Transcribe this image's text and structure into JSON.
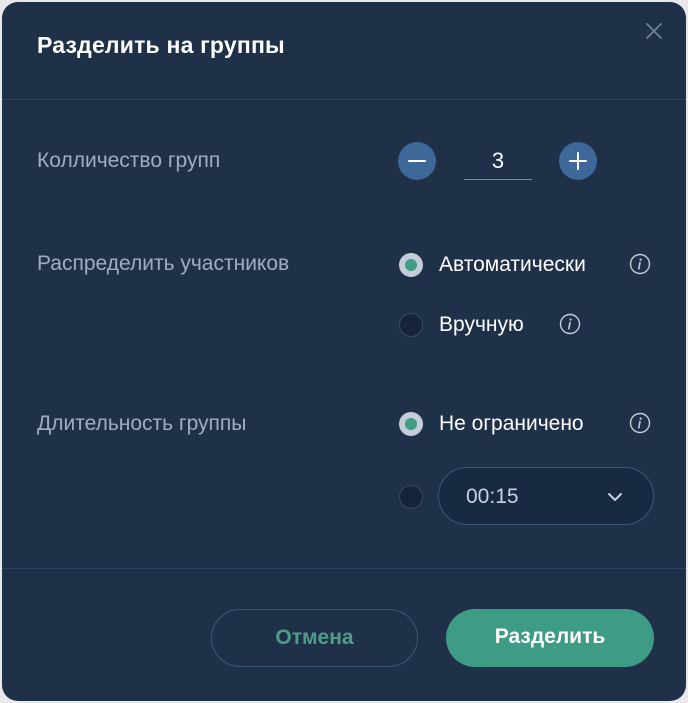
{
  "dialog": {
    "title": "Разделить на группы",
    "close_icon": "close-icon"
  },
  "group_count": {
    "label": "Колличество групп",
    "value": "3",
    "decrement_icon": "minus-icon",
    "increment_icon": "plus-icon"
  },
  "distribution": {
    "label": "Распределить участников",
    "options": [
      {
        "label": "Автоматически",
        "selected": true,
        "info_icon": "info-icon"
      },
      {
        "label": "Вручную",
        "selected": false,
        "info_icon": "info-icon"
      }
    ]
  },
  "duration": {
    "label": "Длительность группы",
    "options": [
      {
        "label": "Не ограничено",
        "selected": true,
        "info_icon": "info-icon"
      },
      {
        "label": "",
        "selected": false
      }
    ],
    "select": {
      "value": "00:15",
      "chevron_icon": "chevron-down-icon"
    }
  },
  "footer": {
    "cancel_label": "Отмена",
    "submit_label": "Разделить"
  },
  "colors": {
    "background": "#1f3149",
    "accent": "#3e9b85",
    "stepper": "#3d6899",
    "label": "#9eaec2"
  }
}
